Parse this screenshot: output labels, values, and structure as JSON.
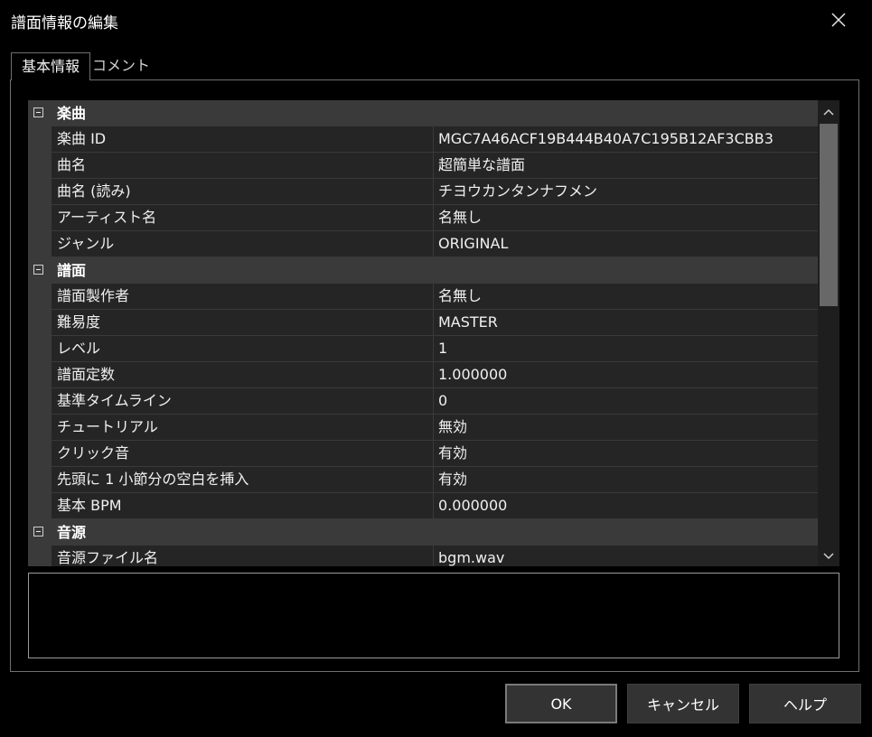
{
  "window": {
    "title": "譜面情報の編集"
  },
  "tabs": [
    {
      "label": "基本情報",
      "active": true
    },
    {
      "label": "コメント",
      "active": false
    }
  ],
  "grid": {
    "categories": [
      {
        "label": "楽曲",
        "expanded": true,
        "properties": [
          {
            "name": "楽曲 ID",
            "value": "MGC7A46ACF19B444B40A7C195B12AF3CBB3"
          },
          {
            "name": "曲名",
            "value": "超簡単な譜面"
          },
          {
            "name": "曲名 (読み)",
            "value": "チヨウカンタンナフメン"
          },
          {
            "name": "アーティスト名",
            "value": "名無し"
          },
          {
            "name": "ジャンル",
            "value": "ORIGINAL"
          }
        ]
      },
      {
        "label": "譜面",
        "expanded": true,
        "properties": [
          {
            "name": "譜面製作者",
            "value": "名無し"
          },
          {
            "name": "難易度",
            "value": "MASTER"
          },
          {
            "name": "レベル",
            "value": "1"
          },
          {
            "name": "譜面定数",
            "value": "1.000000"
          },
          {
            "name": "基準タイムライン",
            "value": "0"
          },
          {
            "name": "チュートリアル",
            "value": "無効"
          },
          {
            "name": "クリック音",
            "value": "有効"
          },
          {
            "name": "先頭に 1 小節分の空白を挿入",
            "value": "有効"
          },
          {
            "name": "基本 BPM",
            "value": "0.000000"
          }
        ]
      },
      {
        "label": "音源",
        "expanded": true,
        "properties": [
          {
            "name": "音源ファイル名",
            "value": "bgm.wav"
          }
        ]
      }
    ]
  },
  "buttons": {
    "ok": "OK",
    "cancel": "キャンセル",
    "help": "ヘルプ"
  },
  "icons": {
    "close": "close-icon",
    "scroll_up": "chevron-up-icon",
    "scroll_down": "chevron-down-icon",
    "collapse": "minus-box-icon"
  }
}
